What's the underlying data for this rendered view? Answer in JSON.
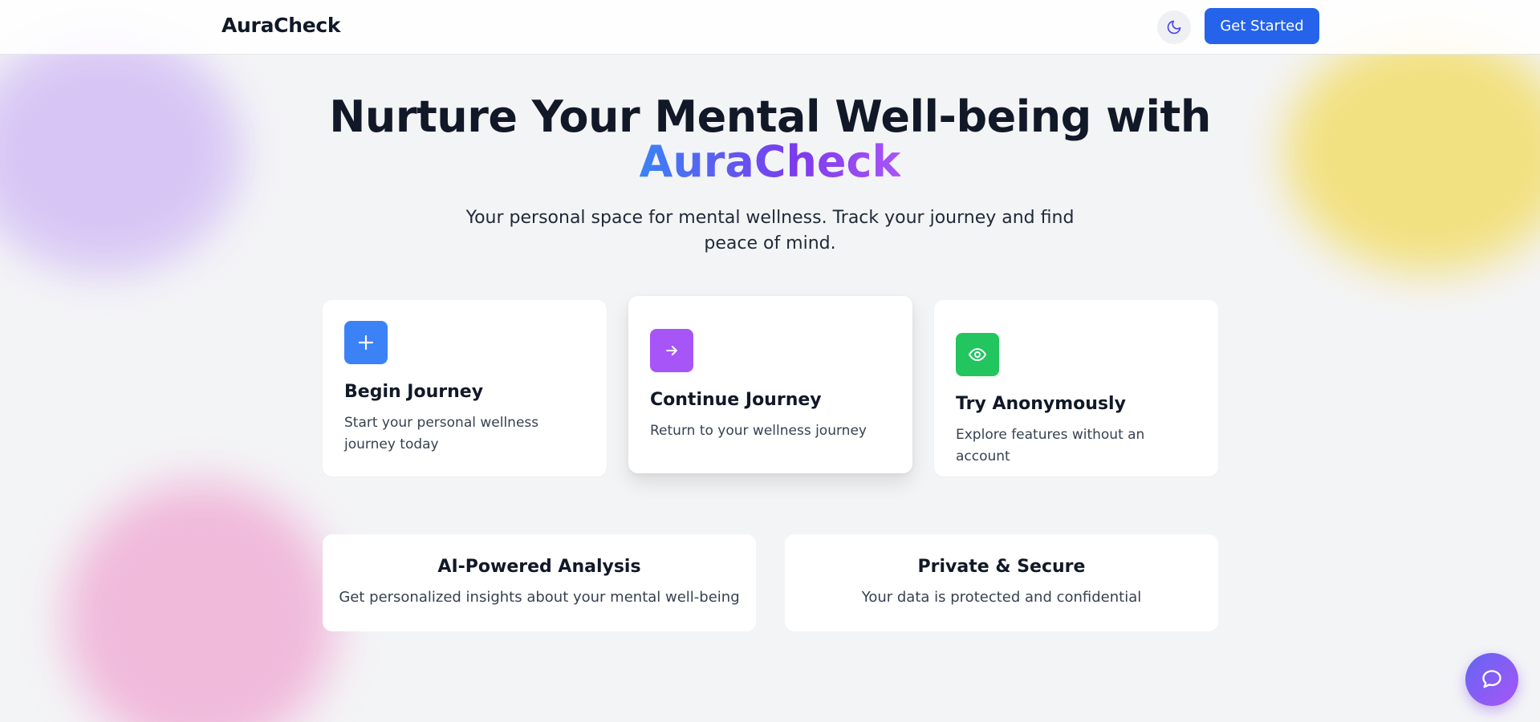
{
  "header": {
    "brand": "AuraCheck",
    "theme_toggle_icon": "moon-icon",
    "cta_label": "Get Started"
  },
  "hero": {
    "title_line": "Nurture Your Mental Well-being with",
    "title_brand": "AuraCheck",
    "subtitle": "Your personal space for mental wellness. Track your journey and find peace of mind."
  },
  "actions": [
    {
      "icon": "plus-icon",
      "color": "#3b82f6",
      "title": "Begin Journey",
      "description": "Start your personal wellness journey today"
    },
    {
      "icon": "arrow-right-icon",
      "color": "#a855f7",
      "title": "Continue Journey",
      "description": "Return to your wellness journey"
    },
    {
      "icon": "eye-icon",
      "color": "#22c55e",
      "title": "Try Anonymously",
      "description": "Explore features without an account"
    }
  ],
  "features": [
    {
      "title": "AI-Powered Analysis",
      "description": "Get personalized insights about your mental well-being"
    },
    {
      "title": "Private & Secure",
      "description": "Your data is protected and confidential"
    }
  ],
  "chat": {
    "icon": "chat-bubble-icon"
  },
  "colors": {
    "accent": "#2563eb",
    "background": "#f3f4f6",
    "gradient_start": "#3b82f6",
    "gradient_end": "#a855f7"
  }
}
